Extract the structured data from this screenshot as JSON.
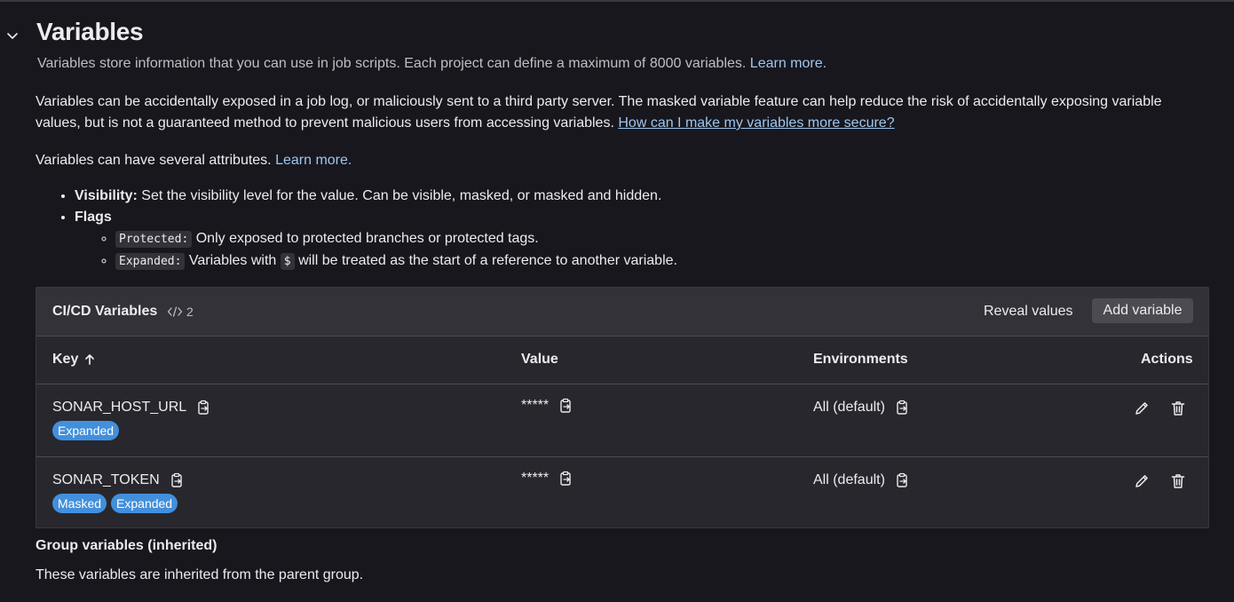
{
  "section": {
    "title": "Variables",
    "subtitle": "Variables store information that you can use in job scripts. Each project can define a maximum of 8000 variables.",
    "subtitle_link": "Learn more.",
    "warning_text": "Variables can be accidentally exposed in a job log, or maliciously sent to a third party server. The masked variable feature can help reduce the risk of accidentally exposing variable values, but is not a guaranteed method to prevent malicious users from accessing variables.",
    "warning_link": "How can I make my variables more secure?",
    "attributes_text": "Variables can have several attributes.",
    "attributes_link": "Learn more.",
    "visibility_label": "Visibility:",
    "visibility_text": "Set the visibility level for the value. Can be visible, masked, or masked and hidden.",
    "flags_label": "Flags",
    "protected_code": "Protected:",
    "protected_text": "Only exposed to protected branches or protected tags.",
    "expanded_code": "Expanded:",
    "expanded_text_before": "Variables with",
    "dollar_code": "$",
    "expanded_text_after": "will be treated as the start of a reference to another variable."
  },
  "table": {
    "title": "CI/CD Variables",
    "count": "2",
    "reveal_label": "Reveal values",
    "add_label": "Add variable",
    "headers": {
      "key": "Key",
      "value": "Value",
      "environments": "Environments",
      "actions": "Actions"
    },
    "rows": [
      {
        "key": "SONAR_HOST_URL",
        "value": "*****",
        "env": "All (default)",
        "badges": [
          "Expanded"
        ]
      },
      {
        "key": "SONAR_TOKEN",
        "value": "*****",
        "env": "All (default)",
        "badges": [
          "Masked",
          "Expanded"
        ]
      }
    ]
  },
  "group": {
    "title": "Group variables (inherited)",
    "description": "These variables are inherited from the parent group."
  },
  "colors": {
    "background": "#18171d",
    "card": "#28272d",
    "header": "#333238",
    "link": "#9dc7f1",
    "badge": "#428fdc"
  },
  "icons": [
    "chevron-down-icon",
    "code-icon",
    "sort-arrow-up-icon",
    "copy-icon",
    "pencil-icon",
    "trash-icon"
  ]
}
